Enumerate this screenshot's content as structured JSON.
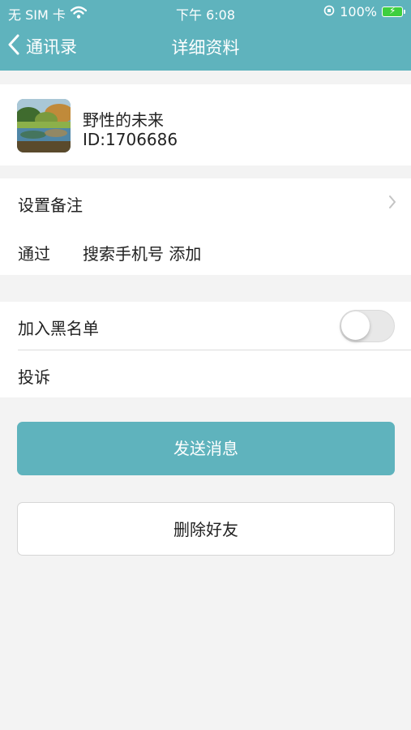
{
  "status_bar": {
    "carrier": "无 SIM 卡",
    "time": "下午 6:08",
    "battery_percent": "100%",
    "icons": [
      "wifi-icon",
      "orientation-lock-icon",
      "battery-charging-icon"
    ]
  },
  "nav": {
    "back_label": "通讯录",
    "title": "详细资料"
  },
  "profile": {
    "name": "野性的未来",
    "id": "ID:1706686"
  },
  "info": {
    "remark_label": "设置备注",
    "source_label": "通过",
    "source_method": "搜索手机号  添加"
  },
  "block": {
    "blacklist_label": "加入黑名单",
    "blacklist_enabled": false,
    "report_label": "投诉"
  },
  "actions": {
    "send_label": "发送消息",
    "delete_label": "删除好友"
  },
  "colors": {
    "accent": "#5fb3bd",
    "background": "#f3f3f3"
  }
}
